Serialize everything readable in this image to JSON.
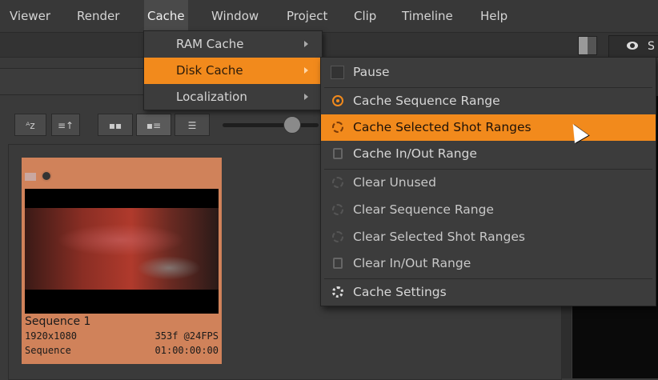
{
  "menubar": {
    "items": [
      "Viewer",
      "Render",
      "Cache",
      "Window",
      "Project",
      "Clip",
      "Timeline",
      "Help"
    ],
    "open": "Cache"
  },
  "viewer_tab": {
    "label": "S"
  },
  "cache_menu": {
    "items": [
      {
        "label": "RAM Cache",
        "submenu": true
      },
      {
        "label": "Disk Cache",
        "submenu": true,
        "highlighted": true
      },
      {
        "label": "Localization",
        "submenu": true
      }
    ]
  },
  "disk_cache_menu": {
    "items": [
      {
        "label": "Pause",
        "icon": "checkbox-icon"
      },
      {
        "label": "Cache Sequence Range",
        "icon": "radio-icon"
      },
      {
        "label": "Cache Selected Shot Ranges",
        "icon": "disk-icon",
        "highlighted": true
      },
      {
        "label": "Cache In/Out Range",
        "icon": "bracket-icon"
      },
      {
        "label": "Clear Unused",
        "icon": "disk-icon"
      },
      {
        "label": "Clear Sequence Range",
        "icon": "disk-icon"
      },
      {
        "label": "Clear Selected Shot Ranges",
        "icon": "disk-icon"
      },
      {
        "label": "Clear In/Out Range",
        "icon": "bracket-icon"
      },
      {
        "label": "Cache Settings",
        "icon": "gear-icon"
      }
    ]
  },
  "bin_toolbar": {
    "sort_az": "ᴬz",
    "sort_order": "≡↑"
  },
  "clip": {
    "name": "Sequence 1",
    "resolution": "1920x1080",
    "frames": "353f @24FPS",
    "kind": "Sequence",
    "timecode": "01:00:00:00"
  },
  "colors": {
    "accent": "#f28a1c",
    "clip_bg": "#d0825a"
  }
}
